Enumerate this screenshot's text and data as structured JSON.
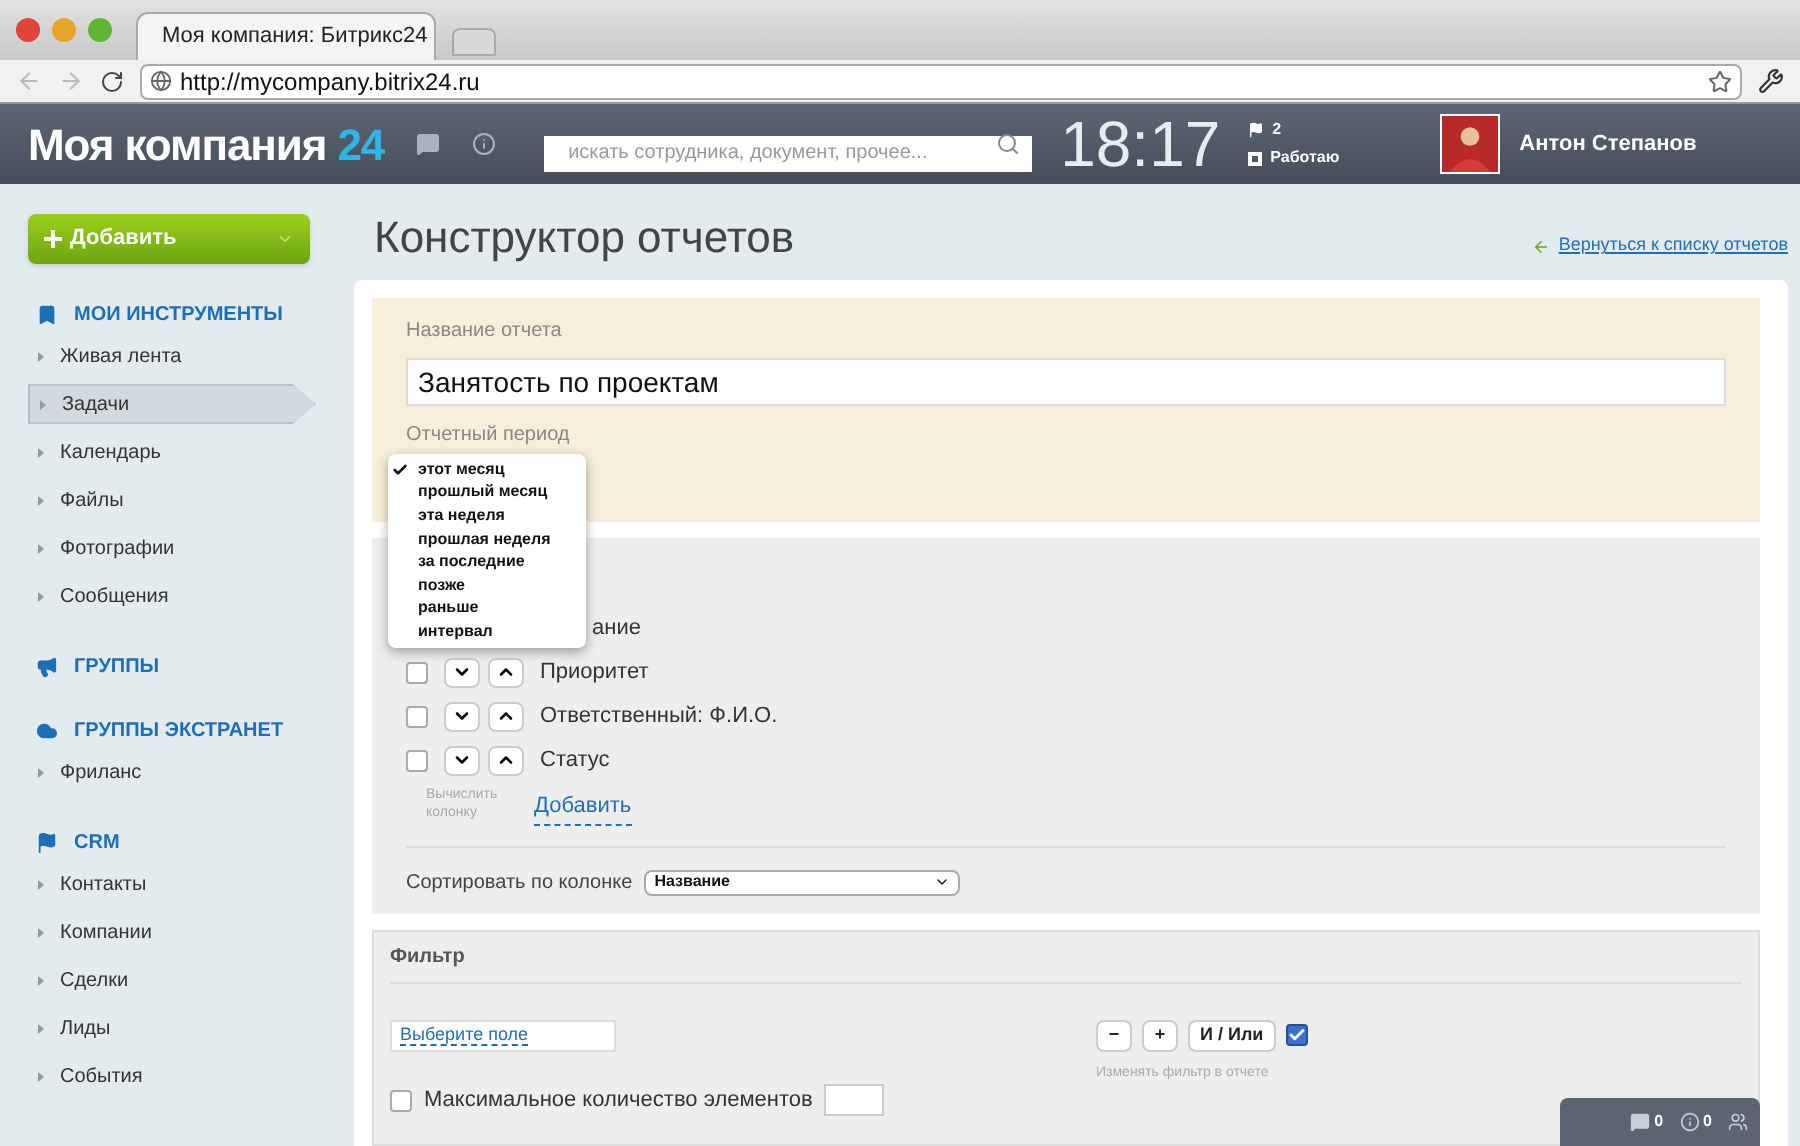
{
  "browser": {
    "tab_title": "Моя компания: Битрикс24",
    "url": "http://mycompany.bitrix24.ru"
  },
  "header": {
    "logo": "Моя компания",
    "logo_num": "24",
    "search_placeholder": "искать сотрудника, документ, прочее...",
    "time": "18:17",
    "flag_count": "2",
    "status": "Работаю",
    "user": "Антон Степанов"
  },
  "sidebar": {
    "add_button": "Добавить",
    "sections": [
      {
        "title": "МОИ ИНСТРУМЕНТЫ",
        "kind": "bookmark",
        "items": [
          {
            "label": "Живая лента",
            "selected": false
          },
          {
            "label": "Задачи",
            "selected": true
          },
          {
            "label": "Календарь",
            "selected": false
          },
          {
            "label": "Файлы",
            "selected": false
          },
          {
            "label": "Фотографии",
            "selected": false
          },
          {
            "label": "Сообщения",
            "selected": false
          }
        ]
      },
      {
        "title": "ГРУППЫ",
        "kind": "megaphone"
      },
      {
        "title": "ГРУППЫ ЭКСТРАНЕТ",
        "kind": "cloud",
        "items": [
          {
            "label": "Фриланс",
            "selected": false
          }
        ]
      },
      {
        "title": "CRM",
        "kind": "flag",
        "items": [
          {
            "label": "Контакты",
            "selected": false
          },
          {
            "label": "Компании",
            "selected": false
          },
          {
            "label": "Сделки",
            "selected": false
          },
          {
            "label": "Лиды",
            "selected": false
          },
          {
            "label": "События",
            "selected": false
          }
        ]
      }
    ]
  },
  "page": {
    "title": "Конструктор отчетов",
    "back_link": "Вернуться к списку отчетов"
  },
  "report": {
    "name_label": "Название отчета",
    "name_value": "Занятость по проектам",
    "period_label": "Отчетный период",
    "period_menu": [
      {
        "label": "этот месяц",
        "selected": true
      },
      {
        "label": "прошлый месяц",
        "selected": false
      },
      {
        "label": "эта неделя",
        "selected": false
      },
      {
        "label": "прошлая неделя",
        "selected": false
      },
      {
        "label": "за последние",
        "selected": false
      },
      {
        "label": "позже",
        "selected": false
      },
      {
        "label": "раньше",
        "selected": false
      },
      {
        "label": "интервал",
        "selected": false
      }
    ]
  },
  "columns": {
    "rows": [
      {
        "label": "ание",
        "kind": "covered"
      },
      {
        "label": "Приоритет",
        "kind": "row",
        "checked": false
      },
      {
        "label": "Ответственный: Ф.И.О.",
        "kind": "row",
        "checked": false
      },
      {
        "label": "Статус",
        "kind": "row",
        "checked": false
      }
    ],
    "calc_hint": "Вычислить колонку",
    "add_link": "Добавить",
    "sort_label": "Сортировать по колонке",
    "sort_value": "Название"
  },
  "filter": {
    "title": "Фильтр",
    "field_link": "Выберите поле",
    "buttons": [
      "−",
      "+",
      "И / Или"
    ],
    "change_checked": true,
    "change_hint": "Изменять фильтр в отчете",
    "max_label": "Максимальное количество элементов",
    "max_checked": false
  },
  "dock": {
    "messages": "0",
    "notifications": "0"
  }
}
